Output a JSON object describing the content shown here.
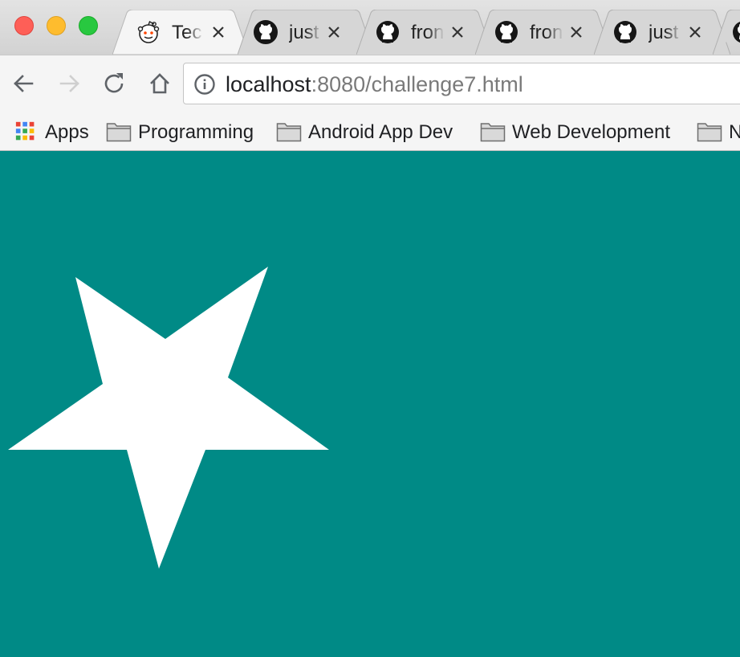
{
  "window": {
    "traffic_lights": [
      "close",
      "minimize",
      "maximize"
    ]
  },
  "tabs": [
    {
      "title": "Tec",
      "icon": "reddit-icon",
      "active": true
    },
    {
      "title": "just",
      "icon": "github-icon",
      "active": false
    },
    {
      "title": "fron",
      "icon": "github-icon",
      "active": false
    },
    {
      "title": "fron",
      "icon": "github-icon",
      "active": false
    },
    {
      "title": "just",
      "icon": "github-icon",
      "active": false
    }
  ],
  "toolbar": {
    "url_host": "localhost",
    "url_path": ":8080/challenge7.html"
  },
  "bookmarks": [
    {
      "label": "Apps",
      "icon": "apps-grid-icon"
    },
    {
      "label": "Programming",
      "icon": "folder-icon"
    },
    {
      "label": "Android App Dev",
      "icon": "folder-icon"
    },
    {
      "label": "Web Development",
      "icon": "folder-icon"
    },
    {
      "label": "N",
      "icon": "folder-icon"
    }
  ],
  "page": {
    "background_color": "#008a86",
    "star_color": "#ffffff"
  }
}
